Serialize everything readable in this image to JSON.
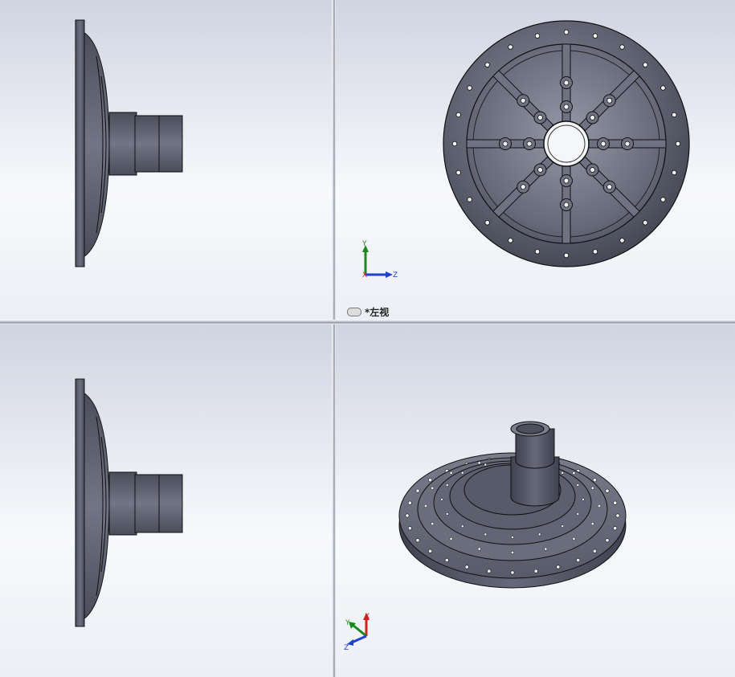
{
  "viewports": {
    "top_right": {
      "view_label": "*左视"
    }
  },
  "triad": {
    "x_label": "X",
    "y_label": "Y",
    "z_label": "Z",
    "colors": {
      "x": "#d02020",
      "y": "#1a8a1a",
      "z": "#2040d0"
    }
  },
  "part_color": "#5e6170"
}
